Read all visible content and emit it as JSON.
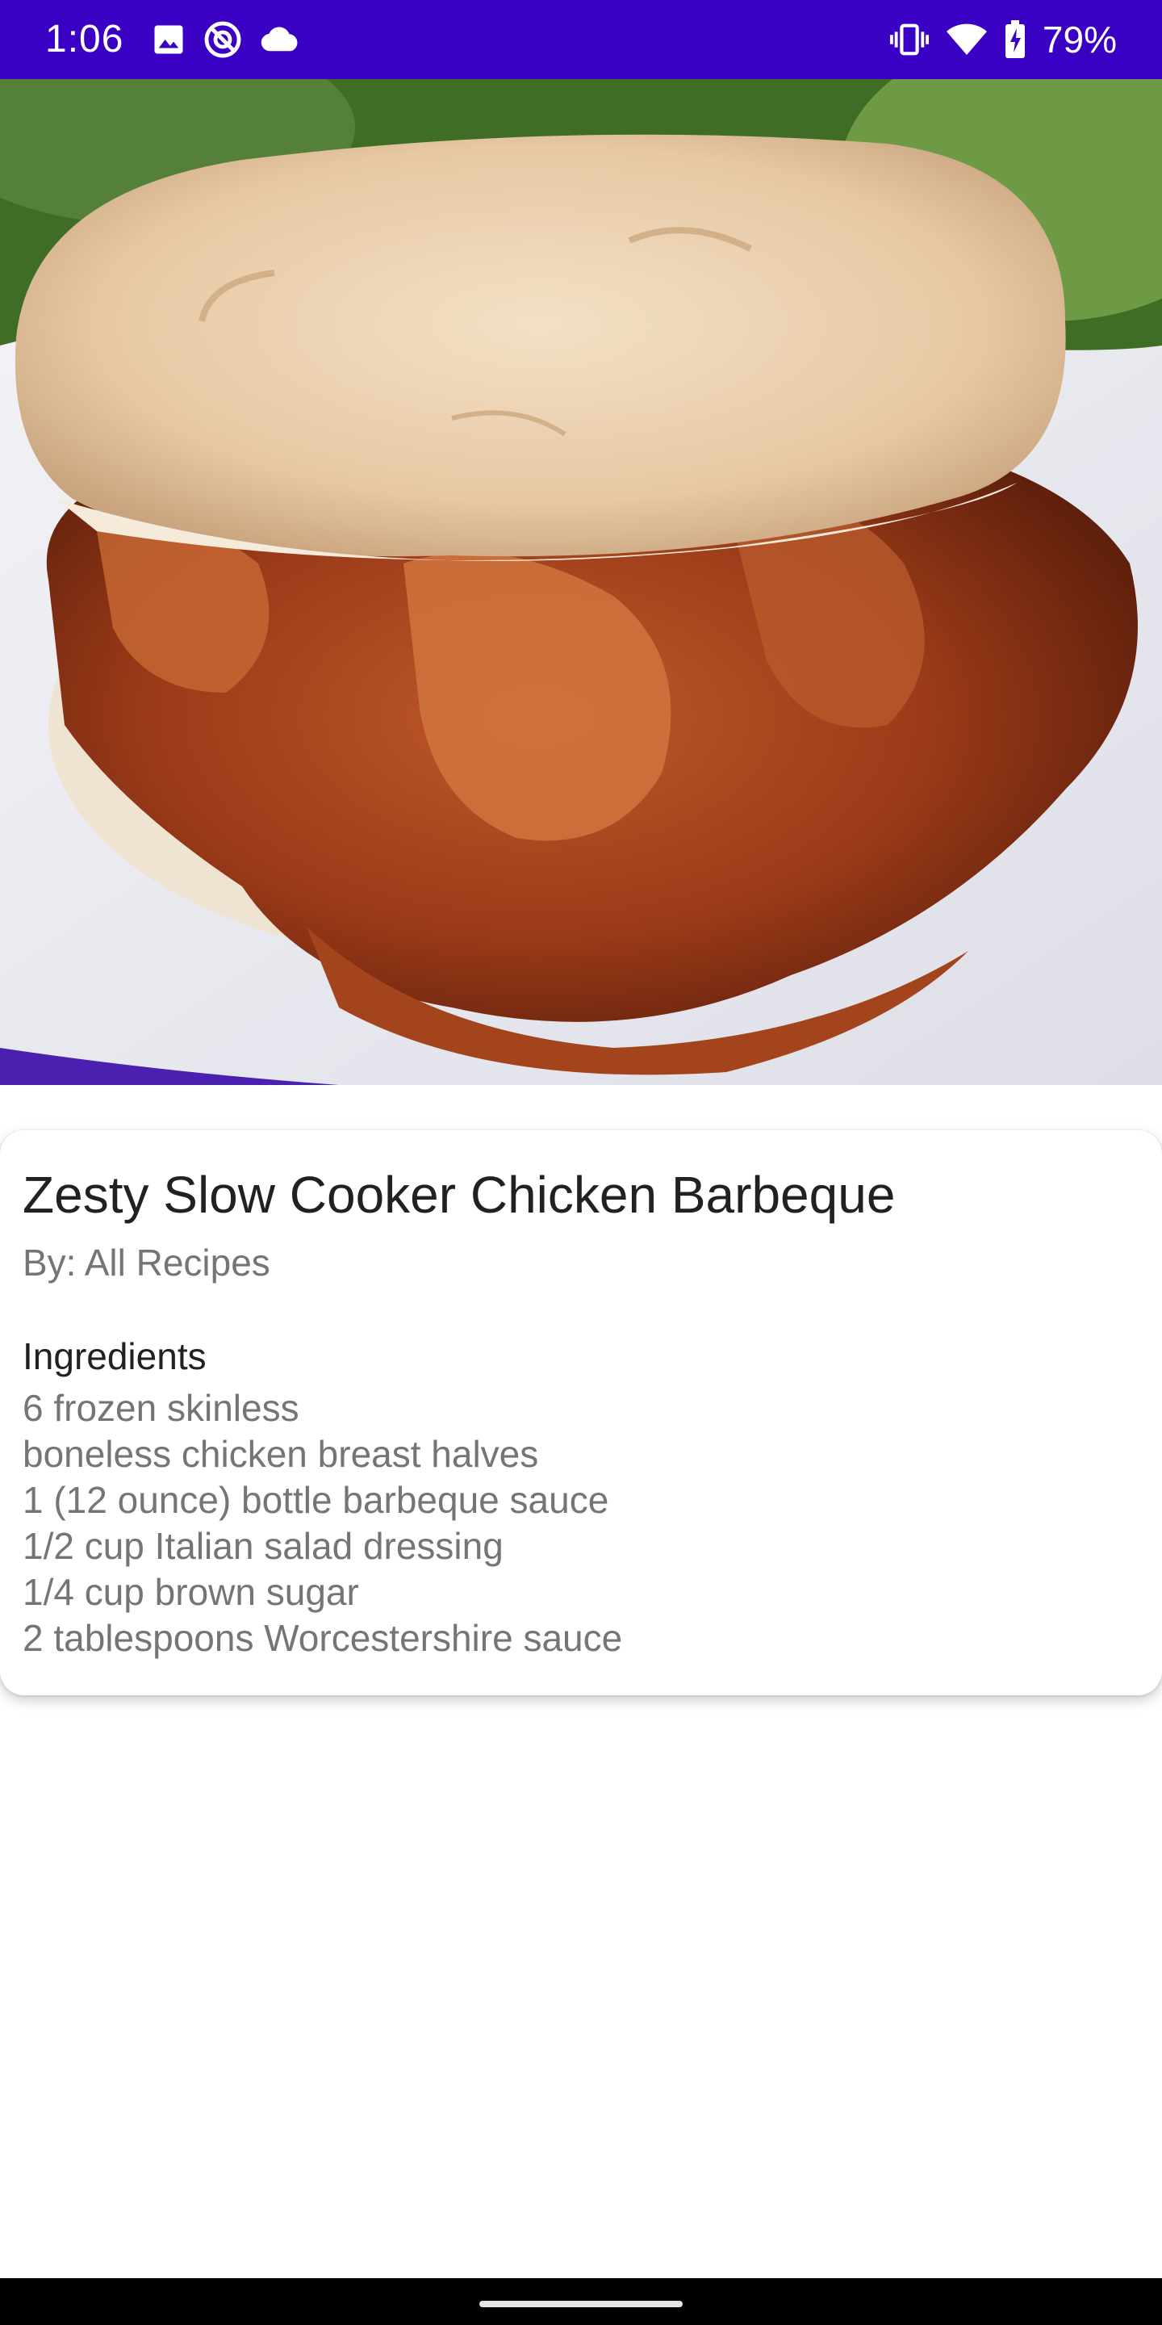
{
  "status_bar": {
    "time": "1:06",
    "battery_percent": "79%",
    "left_icons": [
      "image-icon",
      "sync-off-icon",
      "cloud-icon"
    ],
    "right_icons": [
      "vibrate-icon",
      "wifi-icon",
      "battery-charging-icon"
    ],
    "color": "#3a00c4"
  },
  "hero": {
    "icon": "recipe-photo"
  },
  "recipe": {
    "title": "Zesty Slow Cooker Chicken Barbeque",
    "author": "By: All Recipes",
    "ingredients_heading": "Ingredients",
    "ingredients": [
      "6 frozen skinless",
      "boneless chicken breast halves",
      "1 (12 ounce) bottle barbeque sauce",
      "1/2 cup Italian salad dressing",
      "1/4 cup brown sugar",
      "2 tablespoons Worcestershire sauce"
    ]
  },
  "colors": {
    "title_text": "#212121",
    "secondary_text": "#757575",
    "nav_bar": "#000000"
  }
}
